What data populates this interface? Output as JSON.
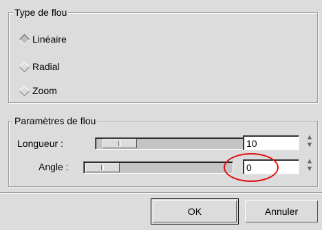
{
  "blur_type": {
    "title": "Type de flou",
    "options": [
      {
        "label": "Linéaire",
        "selected": true
      },
      {
        "label": "Radial",
        "selected": false
      },
      {
        "label": "Zoom",
        "selected": false
      }
    ]
  },
  "params": {
    "title": "Paramètres de flou",
    "length": {
      "label": "Longueur :",
      "value": "10",
      "slider_fraction": 0.1
    },
    "angle": {
      "label": "Angle :",
      "value": "0",
      "slider_fraction": 0.0
    }
  },
  "buttons": {
    "ok": "OK",
    "cancel": "Annuler"
  },
  "spin_glyphs": {
    "up": "▲",
    "down": "▼"
  },
  "annotation": {
    "color": "#e01010"
  }
}
